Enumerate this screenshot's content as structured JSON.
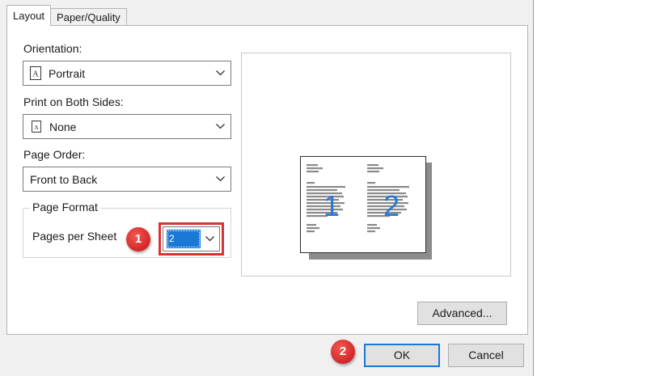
{
  "tabs": [
    {
      "label": "Layout",
      "active": true
    },
    {
      "label": "Paper/Quality",
      "active": false
    }
  ],
  "orientation": {
    "label": "Orientation:",
    "value": "Portrait",
    "icon": "portrait-page-icon"
  },
  "both_sides": {
    "label": "Print on Both Sides:",
    "value": "None",
    "icon": "single-sided-page-icon"
  },
  "page_order": {
    "label": "Page Order:",
    "value": "Front to Back"
  },
  "page_format": {
    "title": "Page Format",
    "pages_per_sheet_label": "Pages per Sheet",
    "pages_per_sheet_value": "2"
  },
  "preview": {
    "page_numbers": [
      "1",
      "2"
    ]
  },
  "annotations": [
    {
      "number": "1",
      "color": "#d9332f"
    },
    {
      "number": "2",
      "color": "#d9332f"
    }
  ],
  "buttons": {
    "advanced": "Advanced...",
    "ok": "OK",
    "cancel": "Cancel"
  },
  "colors": {
    "accent": "#1a78d6",
    "highlight": "#d9332f"
  }
}
